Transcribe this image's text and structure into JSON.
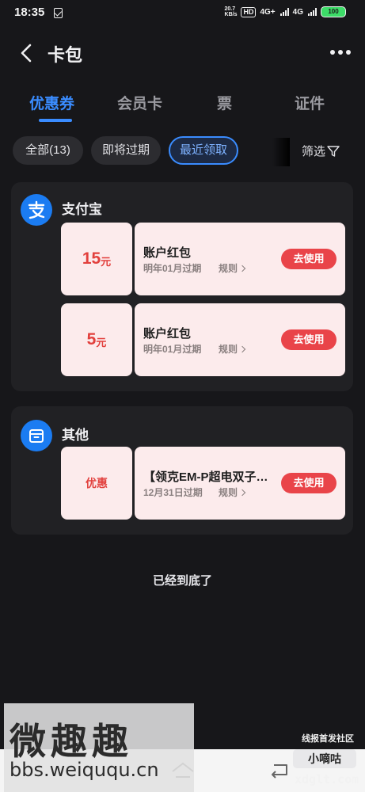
{
  "status": {
    "time": "18:35",
    "speed_top": "20.7",
    "speed_bottom": "KB/s",
    "hd": "HD",
    "net1": "4G+",
    "net2": "4G",
    "battery": "100"
  },
  "header": {
    "title": "卡包",
    "back_icon": "chevron-left-icon",
    "more_icon": "more-dots-icon"
  },
  "tabs": [
    {
      "label": "优惠券",
      "active": true
    },
    {
      "label": "会员卡",
      "active": false
    },
    {
      "label": "票",
      "active": false
    },
    {
      "label": "证件",
      "active": false
    }
  ],
  "filters": {
    "chips": [
      {
        "label": "全部(13)"
      },
      {
        "label": "即将过期"
      },
      {
        "label": "最近领取",
        "active": true
      }
    ],
    "filter_label": "筛选",
    "filter_icon": "funnel-icon"
  },
  "groups": [
    {
      "name": "支付宝",
      "icon": "alipay-icon",
      "coupons": [
        {
          "amount": "15",
          "unit": "元",
          "title": "账户红包",
          "expiry": "明年01月过期",
          "rule": "规则",
          "action": "去使用"
        },
        {
          "amount": "5",
          "unit": "元",
          "title": "账户红包",
          "expiry": "明年01月过期",
          "rule": "规则",
          "action": "去使用"
        }
      ]
    },
    {
      "name": "其他",
      "icon": "box-icon",
      "coupons": [
        {
          "label": "优惠",
          "title": "【领克EM-P超电双子…",
          "expiry": "12月31日过期",
          "rule": "规则",
          "action": "去使用"
        }
      ]
    }
  ],
  "end_text": "已经到底了",
  "watermark": {
    "big": "微趣趣",
    "url": "bbs.weiququ.cn",
    "label": "线报首发社区",
    "small_box": "小嘀咕",
    "site": "xdglt.com"
  },
  "colors": {
    "accent": "#3a8cff",
    "coupon_bg": "#fcebec",
    "price_red": "#e2403d",
    "use_button": "#e94449"
  }
}
